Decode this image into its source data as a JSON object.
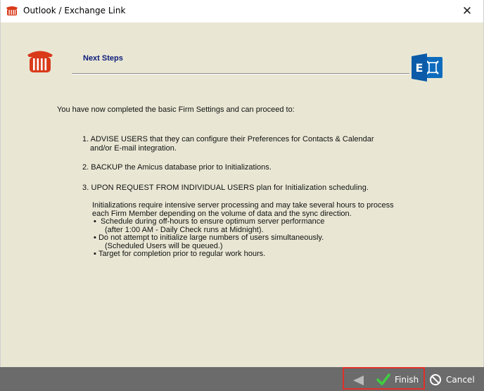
{
  "window": {
    "title": "Outlook / Exchange Link",
    "close_glyph": "✕"
  },
  "header": {
    "heading": "Next Steps"
  },
  "content": {
    "intro": "You have now completed the basic Firm Settings and can proceed to:",
    "step1_line1": "1. ADVISE USERS that they can configure their Preferences for Contacts & Calendar",
    "step1_line2": "and/or E-mail integration.",
    "step2": "2. BACKUP the Amicus database prior to Initializations.",
    "step3": "3. UPON REQUEST FROM INDIVIDUAL USERS plan for Initialization scheduling.",
    "note_line1": "Initializations require intensive server processing and may take several hours to process",
    "note_line2": "each Firm Member depending on the volume of data and the sync direction.",
    "bullet1_line1": "Schedule during off-hours to ensure optimum server performance",
    "bullet1_line2": "(after 1:00 AM - Daily Check runs at Midnight).",
    "bullet2_line1": "Do not attempt to initialize large numbers of users simultaneously.",
    "bullet2_line2": "(Scheduled Users will be queued.)",
    "bullet3": "Target for completion prior to regular work hours."
  },
  "footer": {
    "finish_label": "Finish",
    "cancel_label": "Cancel"
  },
  "icons": {
    "app": "amicus-column-icon",
    "logo": "amicus-column-icon",
    "exchange": "exchange-icon",
    "back": "back-arrow-icon",
    "finish": "checkmark-icon",
    "cancel": "cancel-circle-icon"
  },
  "colors": {
    "body_bg": "#e9e7d4",
    "heading": "#0a1a7a",
    "footer_bg": "#6b6b6b",
    "finish_highlight": "#e0302a",
    "check": "#3fcf3f",
    "exchange_blue": "#0f6cbd",
    "logo_red": "#d93a1a"
  }
}
